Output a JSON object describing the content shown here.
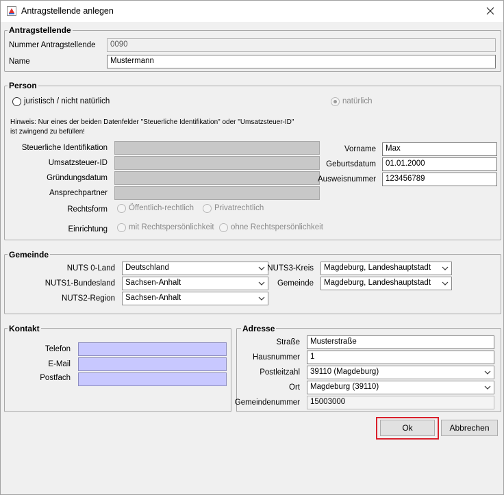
{
  "window": {
    "title": "Antragstellende anlegen"
  },
  "antragstellende": {
    "title": "Antragstellende",
    "nummer_label": "Nummer Antragstellende",
    "nummer_value": "0090",
    "name_label": "Name",
    "name_value": "Mustermann"
  },
  "person": {
    "title": "Person",
    "radio_juristisch": "juristisch / nicht natürlich",
    "radio_natuerlich": "natürlich",
    "hint_line1": "Hinweis: Nur eines der beiden Datenfelder \"Steuerliche Identifikation\" oder \"Umsatzsteuer-ID\"",
    "hint_line2": "ist zwingend zu befüllen!",
    "steuer_label": "Steuerliche Identifikation",
    "ust_label": "Umsatzsteuer-ID",
    "gruendung_label": "Gründungsdatum",
    "ansprech_label": "Ansprechpartner",
    "rechtsform_label": "Rechtsform",
    "rechtsform_opt1": "Öffentlich-rechtlich",
    "rechtsform_opt2": "Privatrechtlich",
    "einrichtung_label": "Einrichtung",
    "einrichtung_opt1": "mit Rechtspersönlichkeit",
    "einrichtung_opt2": "ohne Rechtspersönlichkeit",
    "vorname_label": "Vorname",
    "vorname_value": "Max",
    "geburt_label": "Geburtsdatum",
    "geburt_value": "01.01.2000",
    "ausweis_label": "Ausweisnummer",
    "ausweis_value": "123456789"
  },
  "gemeinde": {
    "title": "Gemeinde",
    "nuts0_label": "NUTS 0-Land",
    "nuts0_value": "Deutschland",
    "nuts1_label": "NUTS1-Bundesland",
    "nuts1_value": "Sachsen-Anhalt",
    "nuts2_label": "NUTS2-Region",
    "nuts2_value": "Sachsen-Anhalt",
    "nuts3_label": "NUTS3-Kreis",
    "nuts3_value": "Magdeburg, Landeshauptstadt",
    "gemeinde_label": "Gemeinde",
    "gemeinde_value": "Magdeburg, Landeshauptstadt"
  },
  "kontakt": {
    "title": "Kontakt",
    "telefon_label": "Telefon",
    "email_label": "E-Mail",
    "postfach_label": "Postfach"
  },
  "adresse": {
    "title": "Adresse",
    "strasse_label": "Straße",
    "strasse_value": "Musterstraße",
    "hausnr_label": "Hausnummer",
    "hausnr_value": "1",
    "plz_label": "Postleitzahl",
    "plz_value": "39110 (Magdeburg)",
    "ort_label": "Ort",
    "ort_value": "Magdeburg (39110)",
    "gemnr_label": "Gemeindenummer",
    "gemnr_value": "15003000"
  },
  "buttons": {
    "ok": "Ok",
    "cancel": "Abbrechen"
  },
  "colors": {
    "highlight": "#d9202c",
    "contact_field": "#c8c8ff",
    "disabled_field": "#c8c8c8"
  }
}
